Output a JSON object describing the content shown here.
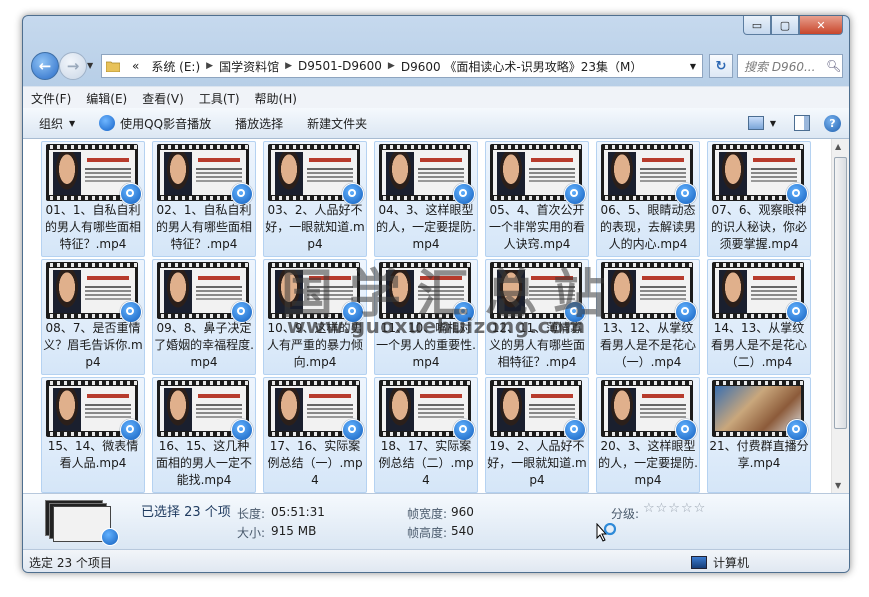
{
  "window": {
    "caption_buttons": [
      "▭",
      "▢",
      "✕"
    ]
  },
  "address": {
    "prefix": "«",
    "crumbs": [
      "系统 (E:)",
      "国学资料馆",
      "D9501-D9600",
      "D9600 《面相读心术-识男攻略》23集（M）"
    ],
    "search_placeholder": "搜索 D960..."
  },
  "menu": [
    "文件(F)",
    "编辑(E)",
    "查看(V)",
    "工具(T)",
    "帮助(H)"
  ],
  "toolbar": {
    "organize": "组织",
    "qq_play": "使用QQ影音播放",
    "play_selection": "播放选择",
    "new_folder": "新建文件夹"
  },
  "files": [
    "01、1、自私自利的男人有哪些面相特征？.mp4",
    "02、1、自私自利的男人有哪些面相特征？.mp4",
    "03、2、人品好不好，一眼就知道.mp4",
    "04、3、这样眼型的人，一定要提防.mp4",
    "05、4、首次公开一个非常实用的看人诀窍.mp4",
    "06、5、眼睛动态的表现，去解读男人的内心.mp4",
    "07、6、观察眼神的识人秘诀，你必须要掌握.mp4",
    "08、7、是否重情义？眉毛告诉你.mp4",
    "09、8、鼻子决定了婚姻的幸福程度.mp4",
    "10、9、这样的男人有严重的暴力倾向.mp4",
    "11、10、嘴相对一个男人的重要性.mp4",
    "12、11、薄情寡义的男人有哪些面相特征？.mp4",
    "13、12、从掌纹看男人是不是花心（一）.mp4",
    "14、13、从掌纹看男人是不是花心（二）.mp4",
    "15、14、微表情看人品.mp4",
    "16、15、这几种面相的男人一定不能找.mp4",
    "17、16、实际案例总结（一）.mp4",
    "18、17、实际案例总结（二）.mp4",
    "19、2、人品好不好，一眼就知道.mp4",
    "20、3、这样眼型的人，一定要提防.mp4",
    "21、付费群直播分享.mp4"
  ],
  "watermark": {
    "title": "国学汇总站",
    "url": "www.guoxuehuizong.com"
  },
  "details": {
    "selected": "已选择 23 个项",
    "length_label": "长度:",
    "length_value": "05:51:31",
    "size_label": "大小:",
    "size_value": "915 MB",
    "width_label": "帧宽度:",
    "width_value": "960",
    "height_label": "帧高度:",
    "height_value": "540",
    "rating_label": "分级:",
    "rating_stars": "☆☆☆☆☆"
  },
  "status": {
    "left": "选定 23 个项目",
    "right": "计算机"
  }
}
